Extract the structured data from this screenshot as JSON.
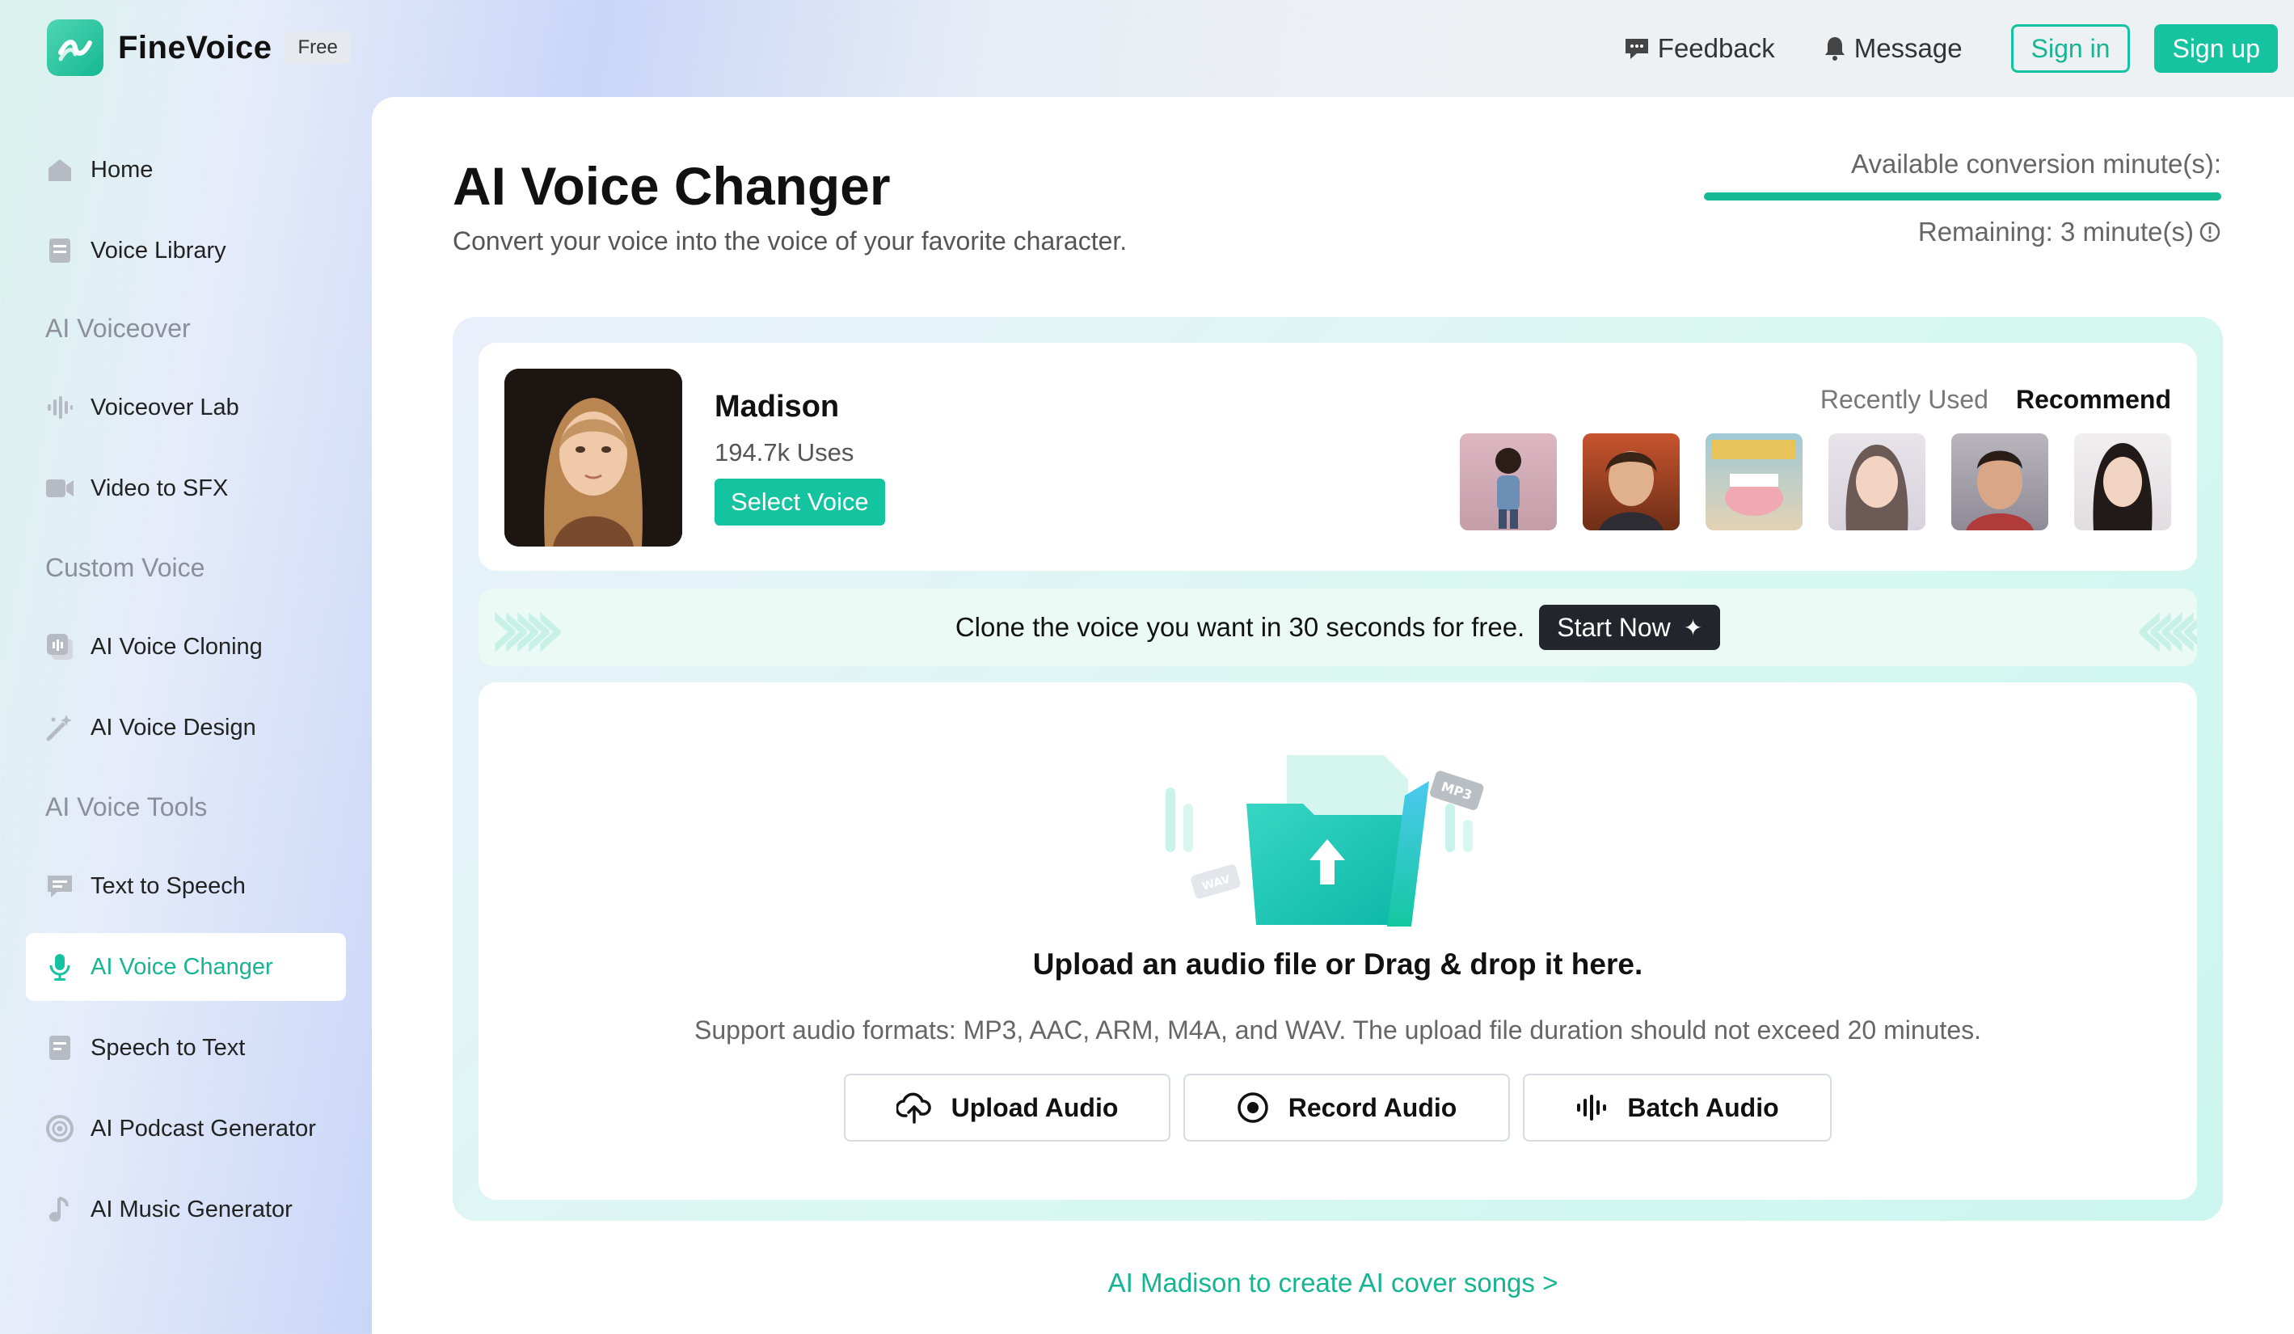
{
  "app": {
    "name": "FineVoice",
    "plan_badge": "Free"
  },
  "topbar": {
    "feedback_label": "Feedback",
    "message_label": "Message",
    "signin_label": "Sign in",
    "signup_label": "Sign up"
  },
  "sidebar": {
    "items": [
      {
        "label": "Home",
        "icon": "home-icon"
      },
      {
        "label": "Voice Library",
        "icon": "library-icon"
      },
      {
        "heading": "AI Voiceover"
      },
      {
        "label": "Voiceover Lab",
        "icon": "waveform-icon"
      },
      {
        "label": "Video to SFX",
        "icon": "video-icon"
      },
      {
        "heading": "Custom Voice"
      },
      {
        "label": "AI Voice Cloning",
        "icon": "clone-icon"
      },
      {
        "label": "AI Voice Design",
        "icon": "magic-wand-icon"
      },
      {
        "heading": "AI Voice Tools"
      },
      {
        "label": "Text to Speech",
        "icon": "chat-icon"
      },
      {
        "label": "AI Voice Changer",
        "icon": "microphone-icon",
        "active": true
      },
      {
        "label": "Speech to Text",
        "icon": "document-icon"
      },
      {
        "label": "AI Podcast Generator",
        "icon": "podcast-icon"
      },
      {
        "label": "AI Music Generator",
        "icon": "music-note-icon"
      }
    ]
  },
  "main": {
    "title": "AI Voice Changer",
    "subtitle": "Convert your voice into the voice of your favorite character.",
    "quota": {
      "label": "Available conversion minute(s):",
      "remaining": "Remaining: 3 minute(s)",
      "fill_fraction": 1.0
    },
    "voice": {
      "name": "Madison",
      "uses": "194.7k Uses",
      "select_label": "Select Voice"
    },
    "voice_tabs": [
      "Recently Used",
      "Recommend"
    ],
    "active_voice_tab": "Recommend",
    "promo": {
      "text": "Clone the voice you want in 30 seconds for free.",
      "button_label": "Start Now"
    },
    "upload": {
      "title": "Upload an audio file or Drag & drop it here.",
      "subtitle": "Support audio formats: MP3, AAC, ARM, M4A, and WAV. The upload file duration should not exceed 20 minutes.",
      "illus_tag_mp3": "MP3",
      "illus_tag_wav": "WAV",
      "buttons": [
        {
          "label": "Upload Audio",
          "icon": "cloud-upload-icon"
        },
        {
          "label": "Record Audio",
          "icon": "record-icon"
        },
        {
          "label": "Batch Audio",
          "icon": "waveform-icon"
        }
      ]
    },
    "cover_link": "AI Madison to create AI cover songs >"
  },
  "colors": {
    "accent": "#16c3a0",
    "active_text": "#16b594",
    "dark_button": "#22252b"
  }
}
